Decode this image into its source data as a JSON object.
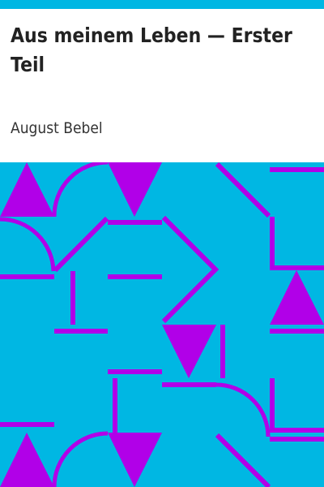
{
  "cover": {
    "title": "Aus meinem Leben — Erster Teil",
    "author": "August Bebel"
  },
  "colors": {
    "top_bar": "#00b7e3",
    "pattern_background": "#00b7e3",
    "pattern_foreground": "#b100e8",
    "title_text": "#222222",
    "author_text": "#333333"
  }
}
